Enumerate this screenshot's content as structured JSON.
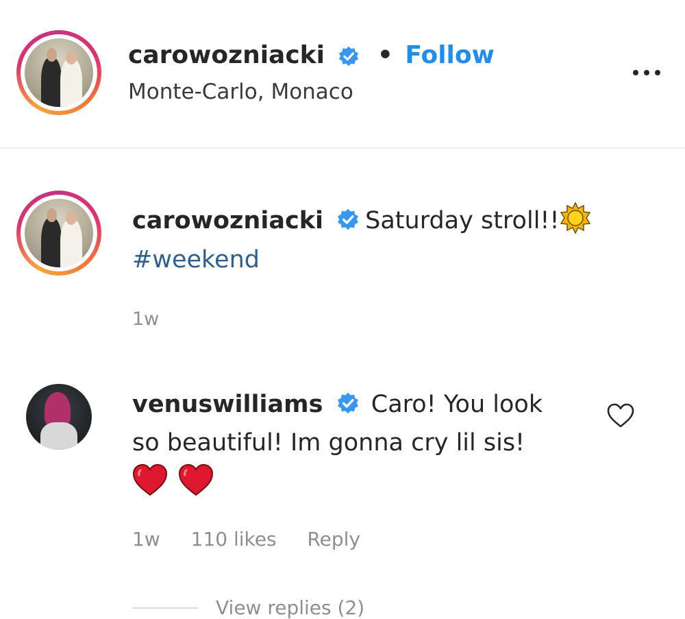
{
  "header": {
    "username": "carowozniacki",
    "follow_label": "Follow",
    "dot": "•",
    "location": "Monte-Carlo, Monaco"
  },
  "caption": {
    "username": "carowozniacki",
    "text": "Saturday stroll!!",
    "emoji": "sun-emoji",
    "hashtag": "#weekend",
    "time": "1w"
  },
  "comment": {
    "username": "venuswilliams",
    "text": "Caro! You look so beautiful! Im gonna cry lil sis!",
    "emoji": "red-heart-emoji x2",
    "time": "1w",
    "likes": "110 likes",
    "reply_label": "Reply",
    "view_replies": "View replies (2)"
  },
  "colors": {
    "verified": "#3897f0",
    "follow": "#1f8ef1",
    "hashtag": "#2f5f8f",
    "muted": "#8e8e8e",
    "heart": "#e0182d"
  }
}
